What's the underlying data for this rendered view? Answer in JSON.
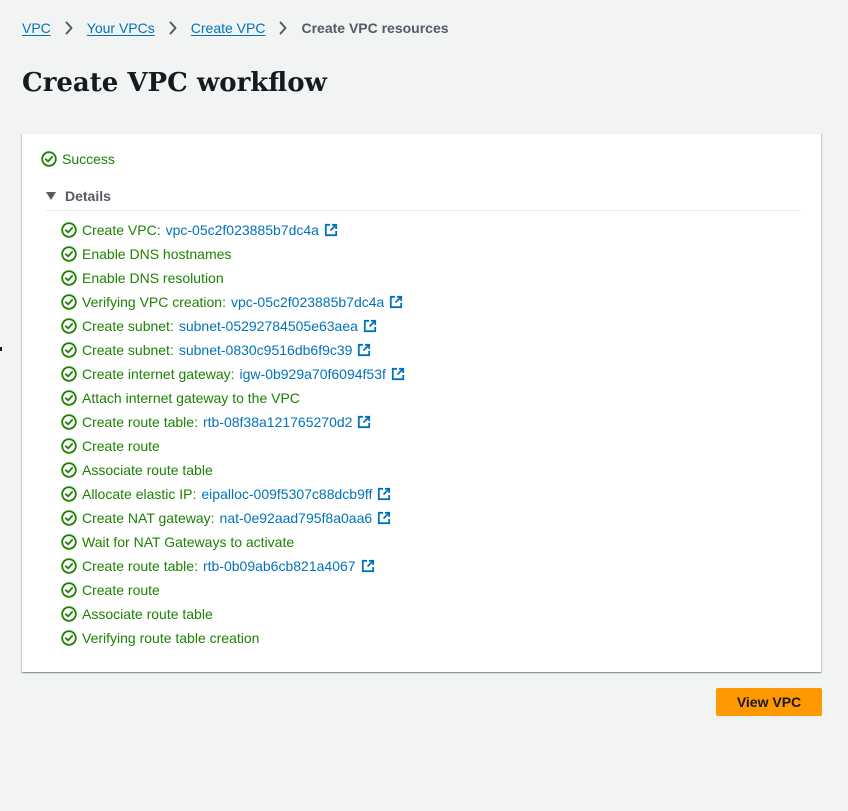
{
  "breadcrumb": {
    "items": [
      "VPC",
      "Your VPCs",
      "Create VPC"
    ],
    "current": "Create VPC resources"
  },
  "page": {
    "title": "Create VPC workflow"
  },
  "status": {
    "label": "Success",
    "color": "#1d8102"
  },
  "details": {
    "label": "Details",
    "expanded": true
  },
  "steps": [
    {
      "label": "Create VPC:",
      "link": "vpc-05c2f023885b7dc4a"
    },
    {
      "label": "Enable DNS hostnames",
      "link": ""
    },
    {
      "label": "Enable DNS resolution",
      "link": ""
    },
    {
      "label": "Verifying VPC creation:",
      "link": "vpc-05c2f023885b7dc4a"
    },
    {
      "label": "Create subnet:",
      "link": "subnet-05292784505e63aea"
    },
    {
      "label": "Create subnet:",
      "link": "subnet-0830c9516db6f9c39"
    },
    {
      "label": "Create internet gateway:",
      "link": "igw-0b929a70f6094f53f"
    },
    {
      "label": "Attach internet gateway to the VPC",
      "link": ""
    },
    {
      "label": "Create route table:",
      "link": "rtb-08f38a121765270d2"
    },
    {
      "label": "Create route",
      "link": ""
    },
    {
      "label": "Associate route table",
      "link": ""
    },
    {
      "label": "Allocate elastic IP:",
      "link": "eipalloc-009f5307c88dcb9ff"
    },
    {
      "label": "Create NAT gateway:",
      "link": "nat-0e92aad795f8a0aa6"
    },
    {
      "label": "Wait for NAT Gateways to activate",
      "link": ""
    },
    {
      "label": "Create route table:",
      "link": "rtb-0b09ab6cb821a4067"
    },
    {
      "label": "Create route",
      "link": ""
    },
    {
      "label": "Associate route table",
      "link": ""
    },
    {
      "label": "Verifying route table creation",
      "link": ""
    }
  ],
  "actions": {
    "view_vpc": "View VPC",
    "primary_color": "#ff9900"
  },
  "colors": {
    "link": "#0073bb",
    "success": "#1d8102",
    "background": "#f2f3f3"
  },
  "icons": {
    "success": "check-circle-icon",
    "external": "external-link-icon",
    "separator": "chevron-right-icon",
    "toggle": "caret-down-icon"
  }
}
